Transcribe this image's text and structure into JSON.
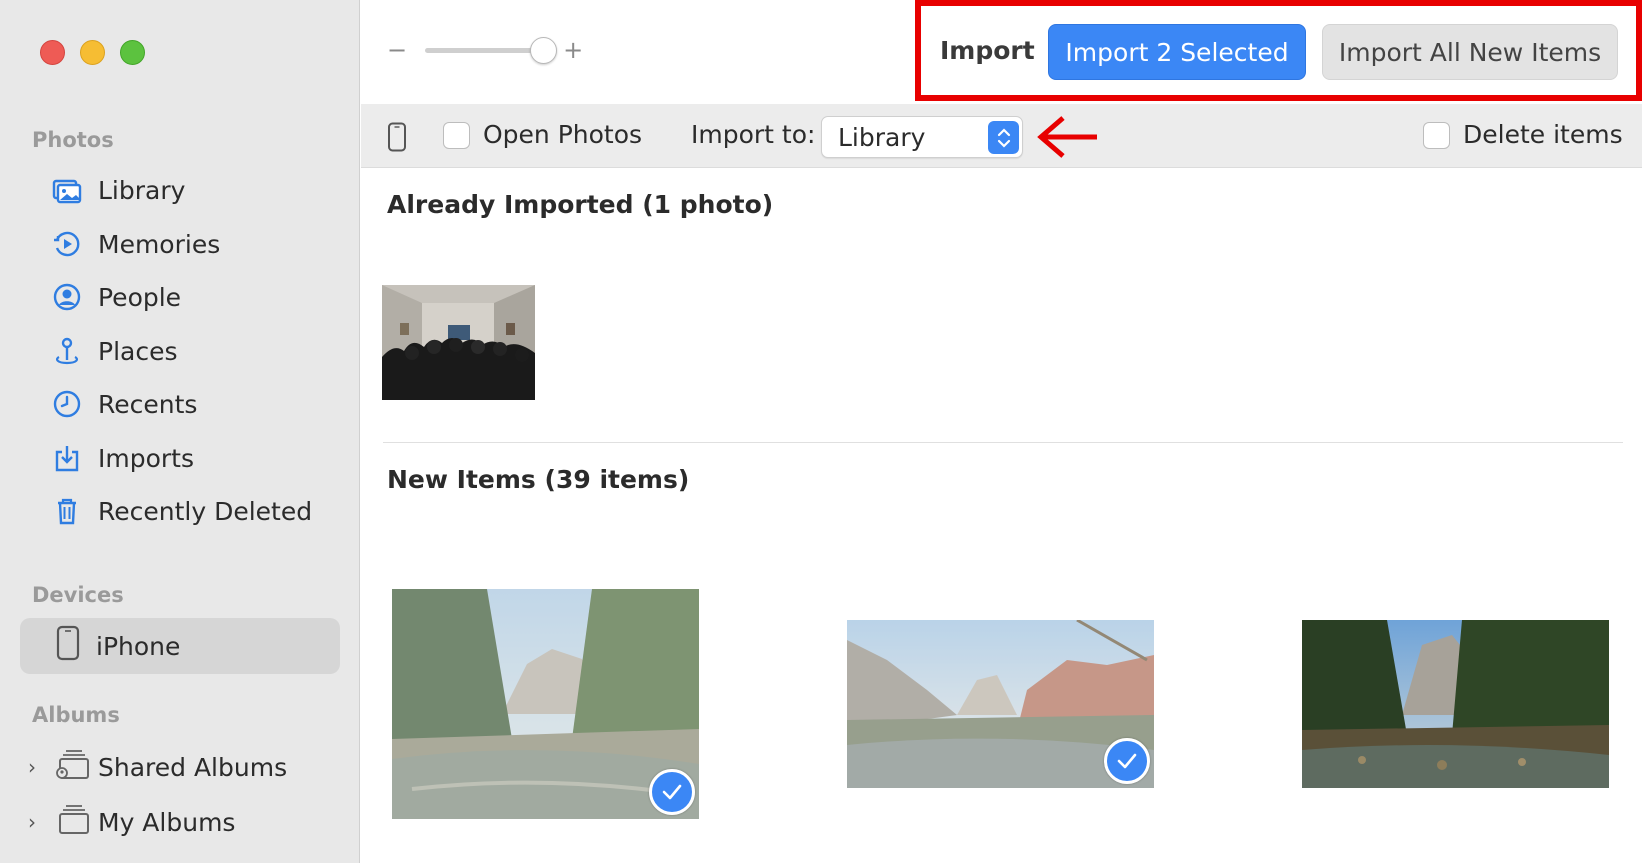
{
  "sidebar": {
    "sections": {
      "photos": "Photos",
      "devices": "Devices",
      "albums": "Albums"
    },
    "photo_items": [
      {
        "label": "Library",
        "icon": "photo-library-icon"
      },
      {
        "label": "Memories",
        "icon": "memories-icon"
      },
      {
        "label": "People",
        "icon": "person-circle-icon"
      },
      {
        "label": "Places",
        "icon": "map-pin-icon"
      },
      {
        "label": "Recents",
        "icon": "clock-icon"
      },
      {
        "label": "Imports",
        "icon": "import-tray-icon"
      },
      {
        "label": "Recently Deleted",
        "icon": "trash-icon"
      }
    ],
    "device": {
      "label": "iPhone",
      "icon": "iphone-icon"
    },
    "album_items": [
      {
        "label": "Shared Albums",
        "icon": "shared-albums-icon"
      },
      {
        "label": "My Albums",
        "icon": "albums-stack-icon"
      }
    ]
  },
  "toolbar": {
    "zoom_minus": "−",
    "zoom_plus": "+",
    "import_label": "Import",
    "import_selected_label": "Import 2 Selected",
    "import_all_label": "Import All New Items"
  },
  "options": {
    "open_photos_label": "Open Photos",
    "import_to_label": "Import to:",
    "import_to_value": "Library",
    "delete_items_label": "Delete items"
  },
  "content": {
    "already_imported_heading": "Already Imported (1 photo)",
    "new_items_heading": "New Items (39 items)",
    "new_items": [
      {
        "selected": true
      },
      {
        "selected": true
      },
      {
        "selected": false
      }
    ]
  },
  "colors": {
    "accent": "#3b87f5",
    "highlight": "#e80000"
  }
}
